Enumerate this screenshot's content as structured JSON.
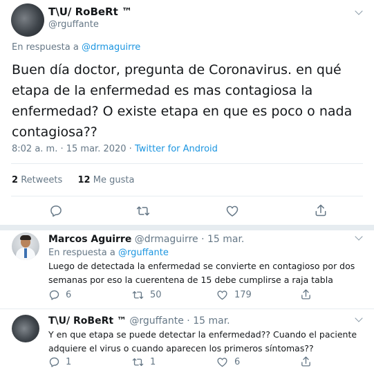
{
  "main_tweet": {
    "author_name": "T\\U/ RoBeRt ™",
    "handle": "@rguffante",
    "reply_prefix": "En respuesta a",
    "reply_to": "@drmaguirre",
    "text_lines": [
      "Buen día doctor, pregunta  de Coronavirus. en qué",
      "etapa de la enfermedad es mas contagiosa la",
      "enfermedad? O existe etapa en que es poco o nada",
      "contagiosa??"
    ],
    "timestamp": "8:02 a. m. · 15 mar. 2020 · ",
    "source": "Twitter for Android",
    "retweets_count": "2",
    "retweets_label": "Retweets",
    "likes_count": "12",
    "likes_label": "Me gusta"
  },
  "replies": [
    {
      "author_name": "Marcos Aguirre",
      "handle_date": "@drmaguirre · 15 mar.",
      "reply_prefix": "En respuesta a",
      "reply_to": "@rguffante",
      "text_lines": [
        "Luego de detectada la enfermedad se convierte en contagioso por dos",
        "semanas por eso la cuerentena de 15 debe cumplirse a raja tabla"
      ],
      "reply_count": "6",
      "retweet_count": "50",
      "like_count": "179"
    },
    {
      "author_name": "T\\U/ RoBeRt ™",
      "handle_date": "@rguffante · 15 mar.",
      "text_lines": [
        "Y en que etapa se puede detectar la enfermedad?? Cuando el paciente",
        "adquiere el virus o cuando aparecen los primeros síntomas??"
      ],
      "reply_count": "1",
      "retweet_count": "1",
      "like_count": "6"
    }
  ],
  "icons": [
    "reply-icon",
    "retweet-icon",
    "like-icon",
    "share-icon",
    "chevron-down-icon"
  ],
  "colors": {
    "link": "#1b95e0",
    "muted": "#657786",
    "text": "#14171a",
    "divider": "#e6ecf0"
  }
}
